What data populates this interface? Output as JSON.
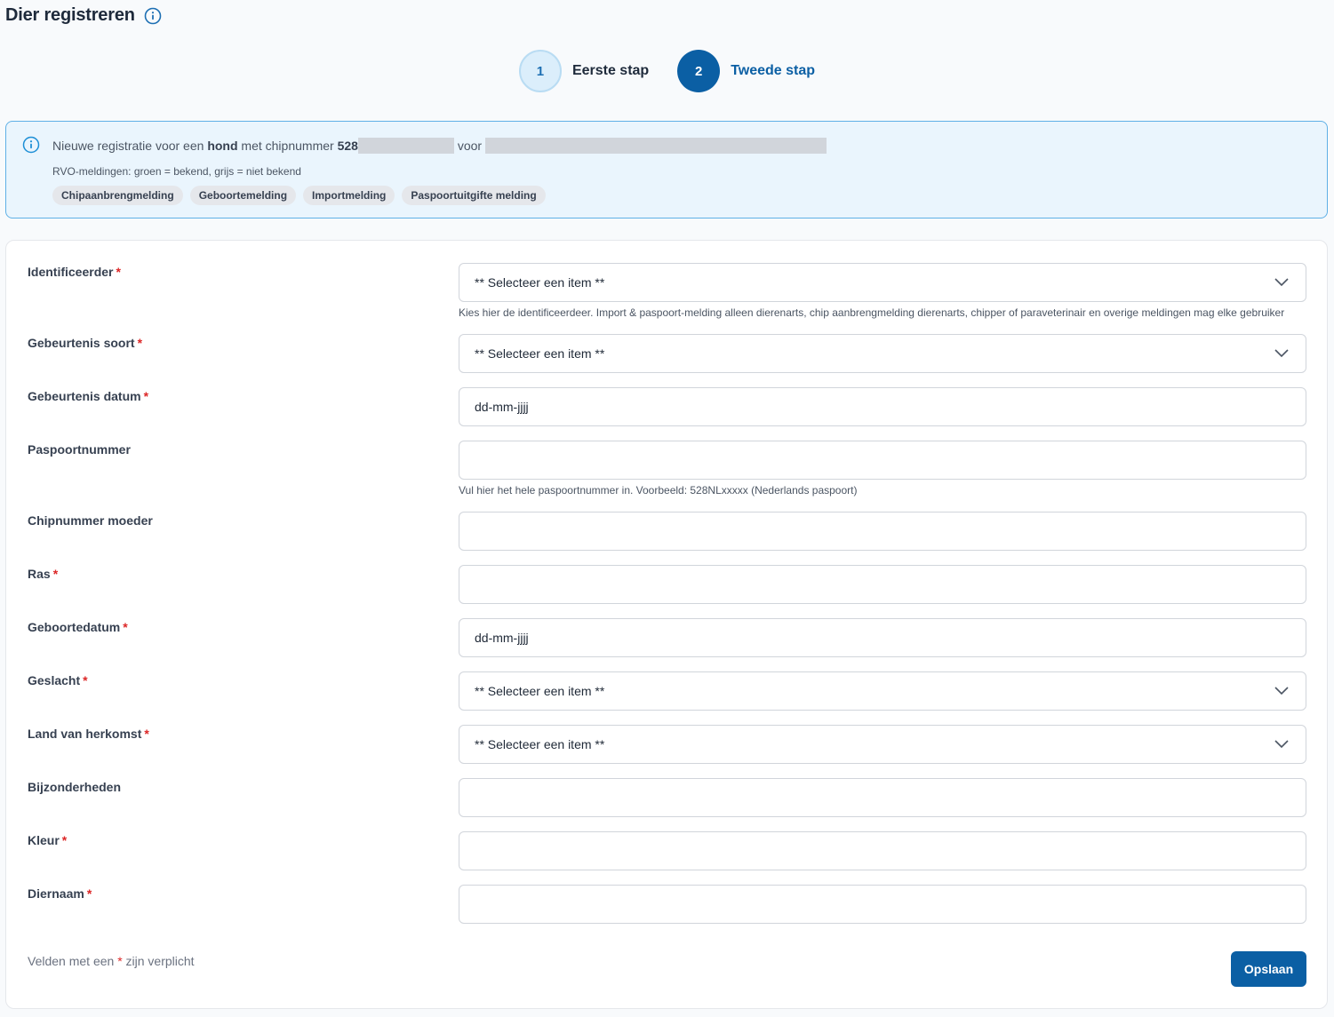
{
  "header": {
    "title": "Dier registreren",
    "info_icon": "info-icon"
  },
  "stepper": {
    "steps": [
      {
        "number": "1",
        "label": "Eerste stap",
        "state": "completed"
      },
      {
        "number": "2",
        "label": "Tweede stap",
        "state": "active"
      }
    ]
  },
  "info_box": {
    "prefix": "Nieuwe registratie voor een",
    "animal": "hond",
    "middle": "met chipnummer",
    "chip_prefix": "528",
    "for_label": "voor",
    "legend": "RVO-meldingen: groen = bekend, grijs = niet bekend",
    "tags": [
      "Chipaanbrengmelding",
      "Geboortemelding",
      "Importmelding",
      "Paspoortuitgifte melding"
    ]
  },
  "form": {
    "fields": [
      {
        "label": "Identificeerder",
        "required": true,
        "type": "select",
        "value": "** Selecteer een item **",
        "hint": "Kies hier de identificeerdeer. Import & paspoort-melding alleen dierenarts, chip aanbrengmelding dierenarts, chipper of paraveterinair en overige meldingen mag elke gebruiker"
      },
      {
        "label": "Gebeurtenis soort",
        "required": true,
        "type": "select",
        "value": "** Selecteer een item **"
      },
      {
        "label": "Gebeurtenis datum",
        "required": true,
        "type": "date",
        "value": "dd-mm-jjjj"
      },
      {
        "label": "Paspoortnummer",
        "required": false,
        "type": "text",
        "value": "",
        "hint": "Vul hier het hele paspoortnummer in. Voorbeeld: 528NLxxxxx (Nederlands paspoort)"
      },
      {
        "label": "Chipnummer moeder",
        "required": false,
        "type": "text",
        "value": ""
      },
      {
        "label": "Ras",
        "required": true,
        "type": "text",
        "value": ""
      },
      {
        "label": "Geboortedatum",
        "required": true,
        "type": "date",
        "value": "dd-mm-jjjj"
      },
      {
        "label": "Geslacht",
        "required": true,
        "type": "select",
        "value": "** Selecteer een item **"
      },
      {
        "label": "Land van herkomst",
        "required": true,
        "type": "select",
        "value": "** Selecteer een item **"
      },
      {
        "label": "Bijzonderheden",
        "required": false,
        "type": "text",
        "value": ""
      },
      {
        "label": "Kleur",
        "required": true,
        "type": "text",
        "value": ""
      },
      {
        "label": "Diernaam",
        "required": true,
        "type": "text",
        "value": ""
      }
    ],
    "required_star": "*",
    "required_note_before": "Velden met een",
    "required_note_after": "zijn verplicht",
    "save_label": "Opslaan"
  },
  "colors": {
    "primary": "#0b5fa4",
    "info_bg": "#eaf5fd",
    "info_border": "#5fb0e6",
    "required": "#dc2626"
  }
}
